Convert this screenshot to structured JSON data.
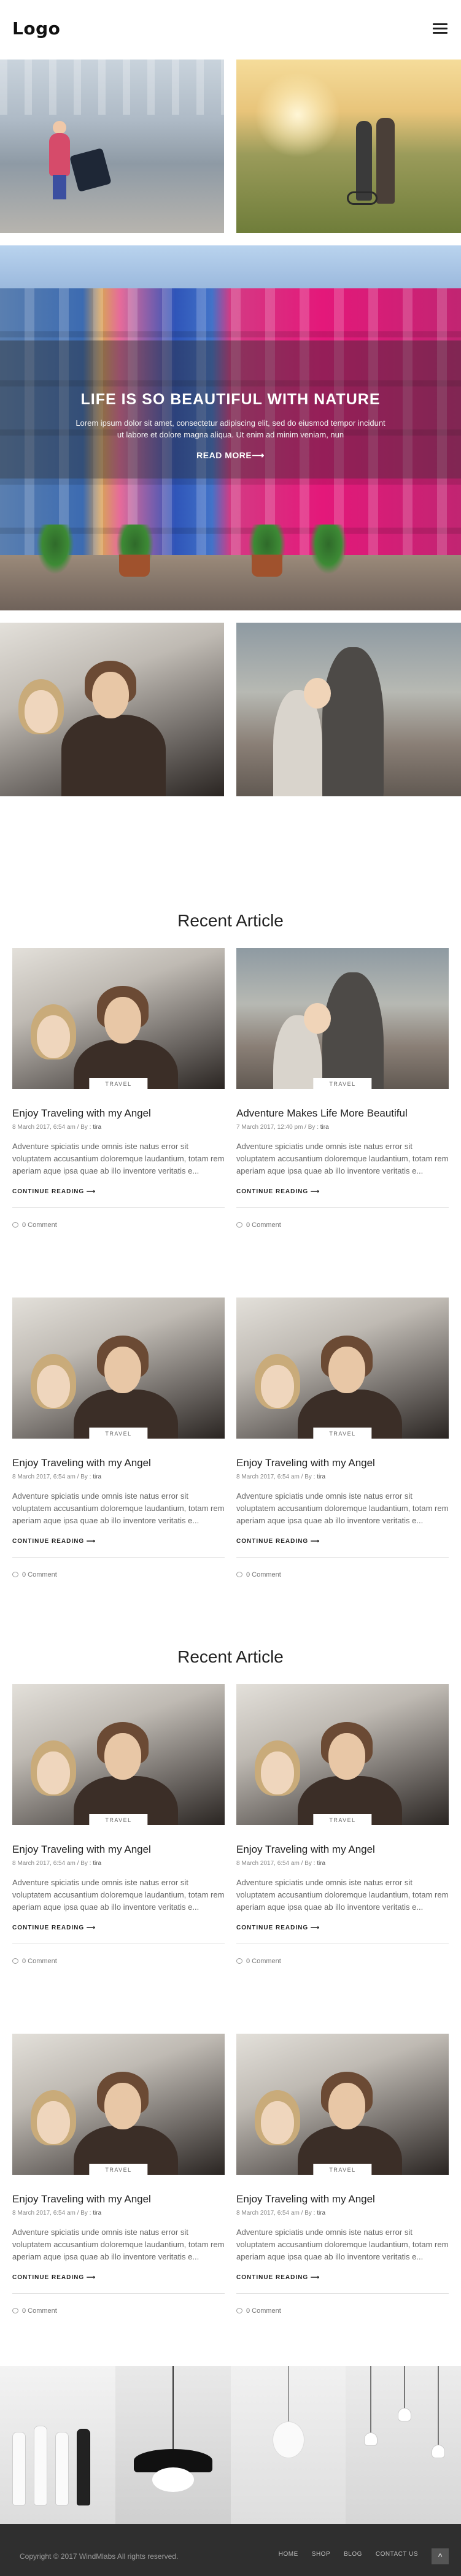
{
  "header": {
    "logo": "Logo",
    "menu_icon": "hamburger-menu-icon"
  },
  "hero": {
    "title": "LIFE IS SO BEAUTIFUL WITH NATURE",
    "text": "Lorem ipsum dolor sit amet, consectetur adipiscing elit, sed do eiusmod tempor incidunt ut labore et dolore magna aliqua. Ut enim ad minim veniam, nun",
    "button": "READ MORE",
    "button_arrow": "⟶",
    "prev_arrow": "‹",
    "next_arrow": "›"
  },
  "sections": [
    {
      "title": "Recent Article",
      "cards": [
        {
          "tag": "TRAVEL",
          "title": "Enjoy Traveling with my Angel",
          "date": "8 March 2017, 6:54 am",
          "by": "By :",
          "author": "tira",
          "excerpt": "Adventure spiciatis unde omnis iste natus error sit voluptatem accusantium doloremque laudantium, totam rem aperiam aque ipsa quae ab illo inventore veritatis e...",
          "more": "CONTINUE READING",
          "comments": "0 Comment"
        },
        {
          "tag": "TRAVEL",
          "title": "Adventure Makes Life More Beautiful",
          "date": "7 March 2017, 12:40 pm",
          "by": "By :",
          "author": "tira",
          "excerpt": "Adventure spiciatis unde omnis iste natus error sit voluptatem accusantium doloremque laudantium, totam rem aperiam aque ipsa quae ab illo inventore veritatis e...",
          "more": "CONTINUE READING",
          "comments": "0 Comment"
        },
        {
          "tag": "TRAVEL",
          "title": "Enjoy Traveling with my Angel",
          "date": "8 March 2017, 6:54 am",
          "by": "By :",
          "author": "tira",
          "excerpt": "Adventure spiciatis unde omnis iste natus error sit voluptatem accusantium doloremque laudantium, totam rem aperiam aque ipsa quae ab illo inventore veritatis e...",
          "more": "CONTINUE READING",
          "comments": "0 Comment"
        },
        {
          "tag": "TRAVEL",
          "title": "Enjoy Traveling with my Angel",
          "date": "8 March 2017, 6:54 am",
          "by": "By :",
          "author": "tira",
          "excerpt": "Adventure spiciatis unde omnis iste natus error sit voluptatem accusantium doloremque laudantium, totam rem aperiam aque ipsa quae ab illo inventore veritatis e...",
          "more": "CONTINUE READING",
          "comments": "0 Comment"
        }
      ]
    },
    {
      "title": "Recent Article",
      "cards": [
        {
          "tag": "TRAVEL",
          "title": "Enjoy Traveling with my Angel",
          "date": "8 March 2017, 6:54 am",
          "by": "By :",
          "author": "tira",
          "excerpt": "Adventure spiciatis unde omnis iste natus error sit voluptatem accusantium doloremque laudantium, totam rem aperiam aque ipsa quae ab illo inventore veritatis e...",
          "more": "CONTINUE READING",
          "comments": "0 Comment"
        },
        {
          "tag": "TRAVEL",
          "title": "Enjoy Traveling with my Angel",
          "date": "8 March 2017, 6:54 am",
          "by": "By :",
          "author": "tira",
          "excerpt": "Adventure spiciatis unde omnis iste natus error sit voluptatem accusantium doloremque laudantium, totam rem aperiam aque ipsa quae ab illo inventore veritatis e...",
          "more": "CONTINUE READING",
          "comments": "0 Comment"
        },
        {
          "tag": "TRAVEL",
          "title": "Enjoy Traveling with my Angel",
          "date": "8 March 2017, 6:54 am",
          "by": "By :",
          "author": "tira",
          "excerpt": "Adventure spiciatis unde omnis iste natus error sit voluptatem accusantium doloremque laudantium, totam rem aperiam aque ipsa quae ab illo inventore veritatis e...",
          "more": "CONTINUE READING",
          "comments": "0 Comment"
        },
        {
          "tag": "TRAVEL",
          "title": "Enjoy Traveling with my Angel",
          "date": "8 March 2017, 6:54 am",
          "by": "By :",
          "author": "tira",
          "excerpt": "Adventure spiciatis unde omnis iste natus error sit voluptatem accusantium doloremque laudantium, totam rem aperiam aque ipsa quae ab illo inventore veritatis e...",
          "more": "CONTINUE READING",
          "comments": "0 Comment"
        }
      ]
    }
  ],
  "footer": {
    "copyright": "Copyright © 2017 WindMlabs All rights reserved.",
    "nav": [
      "HOME",
      "SHOP",
      "BLOG",
      "CONTACT US"
    ],
    "back_to_top": "^"
  },
  "colors": {
    "accent": "#222222",
    "footer_bg": "#2f2f2f",
    "hero_overlay": "#282828"
  }
}
